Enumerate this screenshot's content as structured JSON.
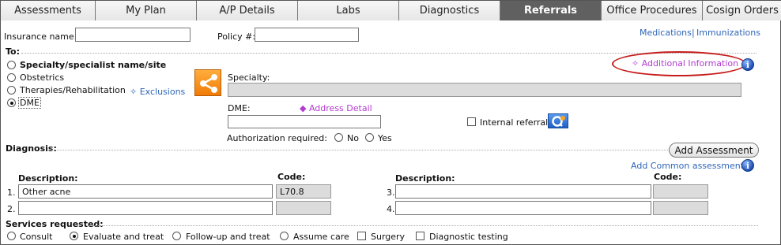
{
  "tabs": [
    {
      "label": "Assessments",
      "active": false
    },
    {
      "label": "My Plan",
      "active": false
    },
    {
      "label": "A/P Details",
      "active": false
    },
    {
      "label": "Labs",
      "active": false
    },
    {
      "label": "Diagnostics",
      "active": false
    },
    {
      "label": "Referrals",
      "active": true
    },
    {
      "label": "Office Procedures",
      "active": false
    },
    {
      "label": "Cosign Orders",
      "active": false
    }
  ],
  "insurance": {
    "name_label": "Insurance name:",
    "name_value": "",
    "policy_label": "Policy #:",
    "policy_value": ""
  },
  "top_links": {
    "medications": "Medications",
    "separator": "|",
    "immunizations": "Immunizations"
  },
  "to": {
    "label": "To:",
    "options": [
      "Specialty/specialist name/site",
      "Obstetrics",
      "Therapies/Rehabilitation",
      "DME"
    ],
    "selected": "DME",
    "exclusions_link": "Exclusions"
  },
  "additional_information": "Additional Information",
  "specialty": {
    "label": "Specialty:",
    "value": ""
  },
  "dme": {
    "label": "DME:",
    "value": "",
    "address_detail": "Address Detail"
  },
  "internal_referral": {
    "label": "Internal referral",
    "checked": false
  },
  "authorization": {
    "label": "Authorization required:",
    "no": "No",
    "yes": "Yes",
    "selected": ""
  },
  "diagnosis": {
    "label": "Diagnosis:",
    "add_assessment": "Add Assessment",
    "add_common": "Add Common assessment",
    "description_label": "Description:",
    "code_label": "Code:",
    "rows": [
      {
        "num": "1.",
        "description": "Other acne",
        "code": "L70.8"
      },
      {
        "num": "2.",
        "description": "",
        "code": ""
      },
      {
        "num": "3.",
        "description": "",
        "code": ""
      },
      {
        "num": "4.",
        "description": "",
        "code": ""
      }
    ]
  },
  "services": {
    "label": "Services requested:",
    "consult": "Consult",
    "evaluate": "Evaluate and treat",
    "followup": "Follow-up and treat",
    "assume": "Assume care",
    "surgery": "Surgery",
    "diagnostic": "Diagnostic testing",
    "selected": "Evaluate and treat"
  },
  "colors": {
    "accent_link": "#2f66b8",
    "purple_link": "#b23bd1",
    "highlight_ellipse": "#c61c1c",
    "active_tab": "#606060"
  }
}
